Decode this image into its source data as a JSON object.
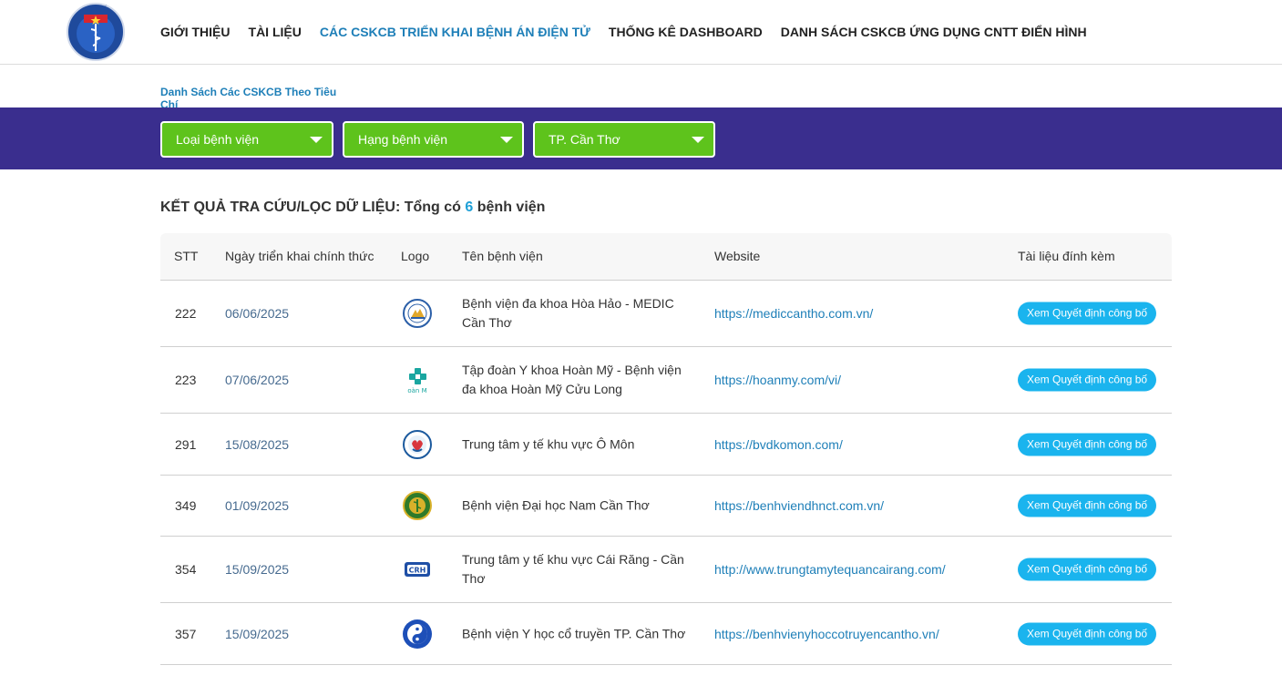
{
  "header": {
    "logo_text": "BỘ Y TẾ",
    "nav": [
      {
        "label": "GIỚI THIỆU",
        "active": false
      },
      {
        "label": "TÀI LIỆU",
        "active": false
      },
      {
        "label": "CÁC CSKCB TRIỂN KHAI BỆNH ÁN ĐIỆN TỬ",
        "active": true
      },
      {
        "label": "THỐNG KÊ DASHBOARD",
        "active": false
      },
      {
        "label": "DANH SÁCH CSKCB ỨNG DỤNG CNTT ĐIỂN HÌNH",
        "active": false
      }
    ]
  },
  "subtab": {
    "label": "Danh Sách Các CSKCB Theo Tiêu Chí"
  },
  "filters": {
    "hospital_type": "Loại bệnh viện",
    "hospital_rank": "Hạng bệnh viện",
    "province": "TP. Cần Thơ"
  },
  "results": {
    "prefix": "KẾT QUẢ TRA CỨU/LỌC DỮ LIỆU: Tổng có",
    "count": "6",
    "suffix": "bệnh viện"
  },
  "table": {
    "headers": {
      "stt": "STT",
      "date": "Ngày triển khai chính thức",
      "logo": "Logo",
      "name": "Tên bệnh viện",
      "website": "Website",
      "attachment": "Tài liệu đính kèm"
    },
    "button_label": "Xem Quyết định công bố",
    "rows": [
      {
        "stt": "222",
        "date": "06/06/2025",
        "name": "Bệnh viện đa khoa Hòa Hảo - MEDIC Cần Thơ",
        "website": "https://mediccantho.com.vn/",
        "logo_icon": "medic-logo-icon"
      },
      {
        "stt": "223",
        "date": "07/06/2025",
        "name": "Tập đoàn Y khoa Hoàn Mỹ - Bệnh viện đa khoa Hoàn Mỹ Cửu Long",
        "website": "https://hoanmy.com/vi/",
        "logo_icon": "hoanmy-logo-icon"
      },
      {
        "stt": "291",
        "date": "15/08/2025",
        "name": "Trung tâm y tế khu vực Ô Môn",
        "website": "https://bvdkomon.com/",
        "logo_icon": "omon-logo-icon"
      },
      {
        "stt": "349",
        "date": "01/09/2025",
        "name": "Bệnh viện Đại học Nam Cần Thơ",
        "website": "https://benhviendhnct.com.vn/",
        "logo_icon": "namcantho-logo-icon"
      },
      {
        "stt": "354",
        "date": "15/09/2025",
        "name": "Trung tâm y tế khu vực Cái Răng - Cần Thơ",
        "website": "http://www.trungtamytequancairang.com/",
        "logo_icon": "crh-logo-icon"
      },
      {
        "stt": "357",
        "date": "15/09/2025",
        "name": "Bệnh viện Y học cổ truyền TP. Cần Thơ",
        "website": "https://benhvienyhoccotruyencantho.vn/",
        "logo_icon": "yhct-logo-icon"
      }
    ]
  },
  "colors": {
    "filter_bar": "#3a2e8e",
    "select_bg": "#5ec31c",
    "accent": "#1e7fb8",
    "button": "#1ab4ee"
  }
}
